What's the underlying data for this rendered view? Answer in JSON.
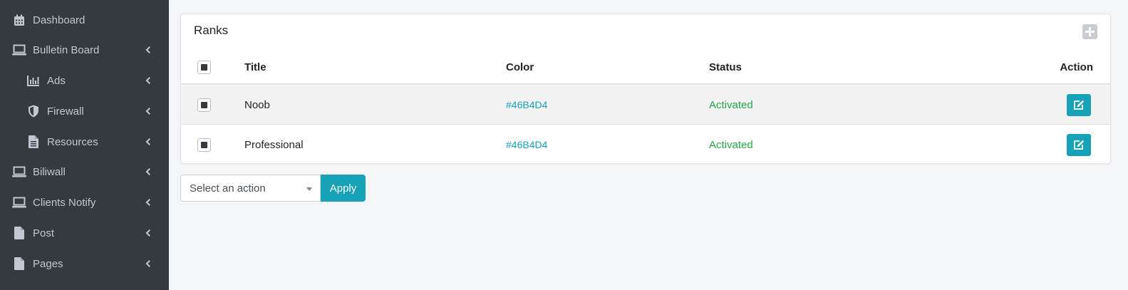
{
  "sidebar": {
    "items": [
      {
        "label": "Dashboard",
        "icon": "calendar-icon"
      },
      {
        "label": "Bulletin Board",
        "icon": "laptop-icon"
      },
      {
        "label": "Ads",
        "icon": "bar-chart-icon"
      },
      {
        "label": "Firewall",
        "icon": "shield-icon"
      },
      {
        "label": "Resources",
        "icon": "file-icon"
      },
      {
        "label": "Biliwall",
        "icon": "laptop-icon"
      },
      {
        "label": "Clients Notify",
        "icon": "laptop-icon"
      },
      {
        "label": "Post",
        "icon": "file-icon"
      },
      {
        "label": "Pages",
        "icon": "file-icon"
      }
    ]
  },
  "card": {
    "title": "Ranks",
    "add_icon": "plus-square-icon"
  },
  "table": {
    "headers": {
      "title": "Title",
      "color": "Color",
      "status": "Status",
      "action": "Action"
    },
    "rows": [
      {
        "title": "Noob",
        "color": "#46B4D4",
        "status": "Activated",
        "action_icon": "edit-icon"
      },
      {
        "title": "Professional",
        "color": "#46B4D4",
        "status": "Activated",
        "action_icon": "edit-icon"
      }
    ]
  },
  "bulk": {
    "select_value": "Select an action",
    "apply_label": "Apply"
  },
  "colors": {
    "sidebar_bg": "#343a40",
    "accent": "#17a2b8",
    "status_active": "#28a745"
  }
}
